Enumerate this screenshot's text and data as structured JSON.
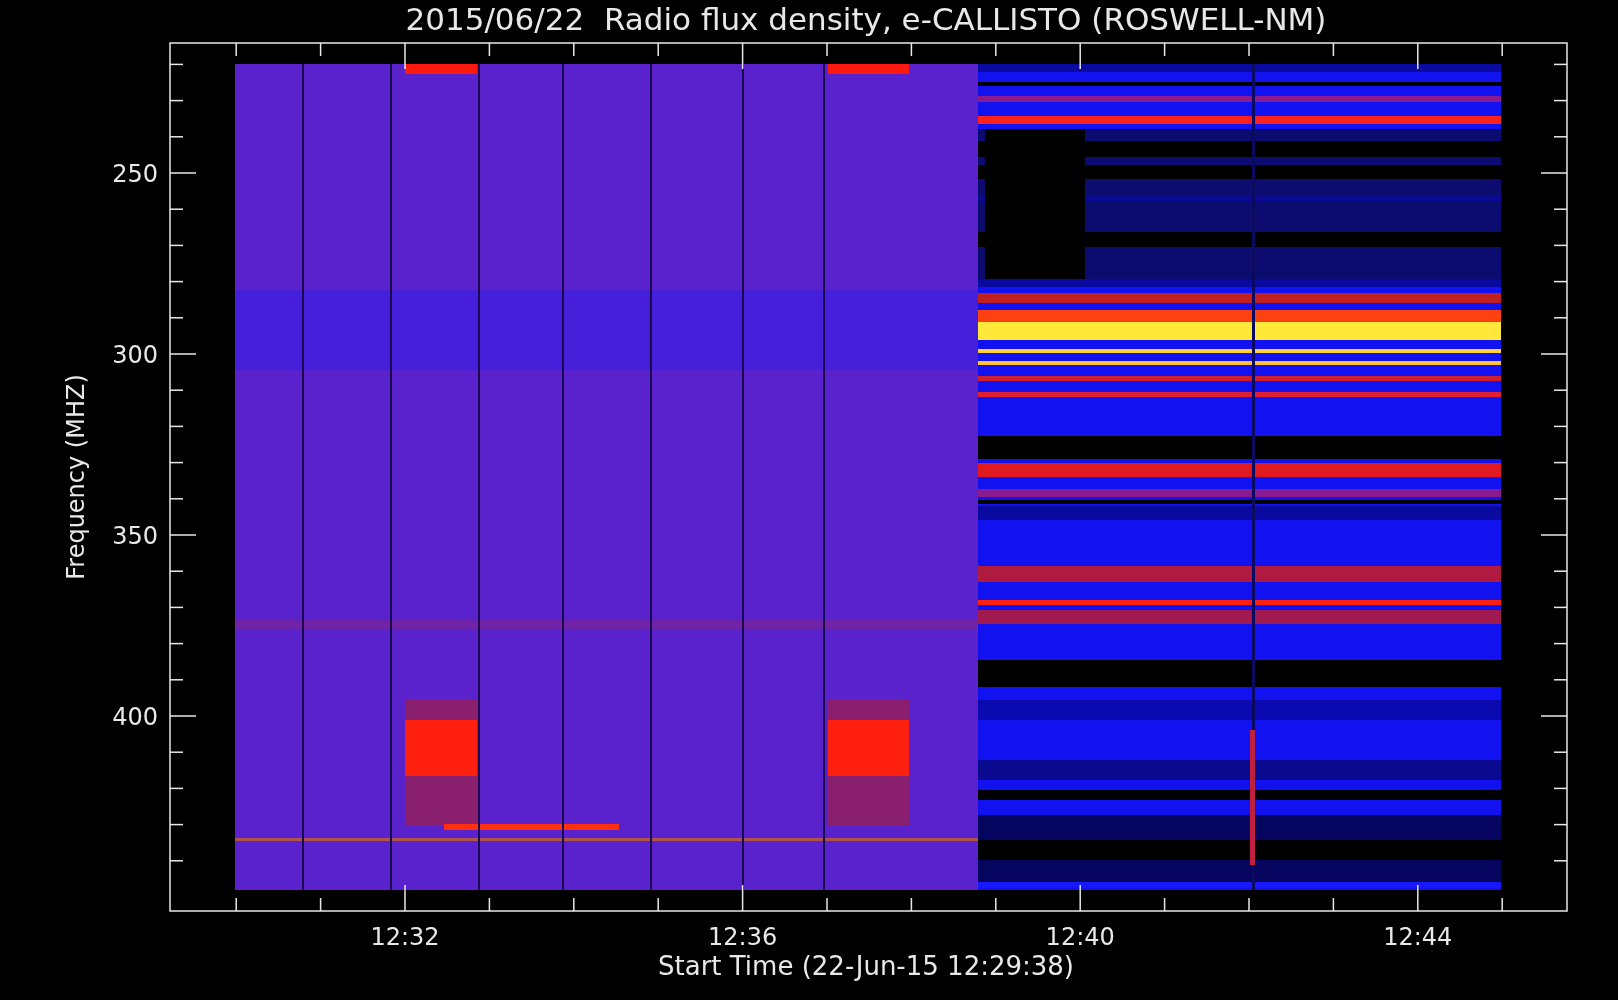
{
  "title": "2015/06/22  Radio flux density, e-CALLISTO (ROSWELL-NM)",
  "y_axis": {
    "label": "Frequency (MHZ)",
    "ticks": [
      "250",
      "300",
      "350",
      "400"
    ]
  },
  "x_axis": {
    "label": "Start Time (22-Jun-15 12:29:38)",
    "ticks": [
      "12:32",
      "12:36",
      "12:40",
      "12:44"
    ]
  }
}
